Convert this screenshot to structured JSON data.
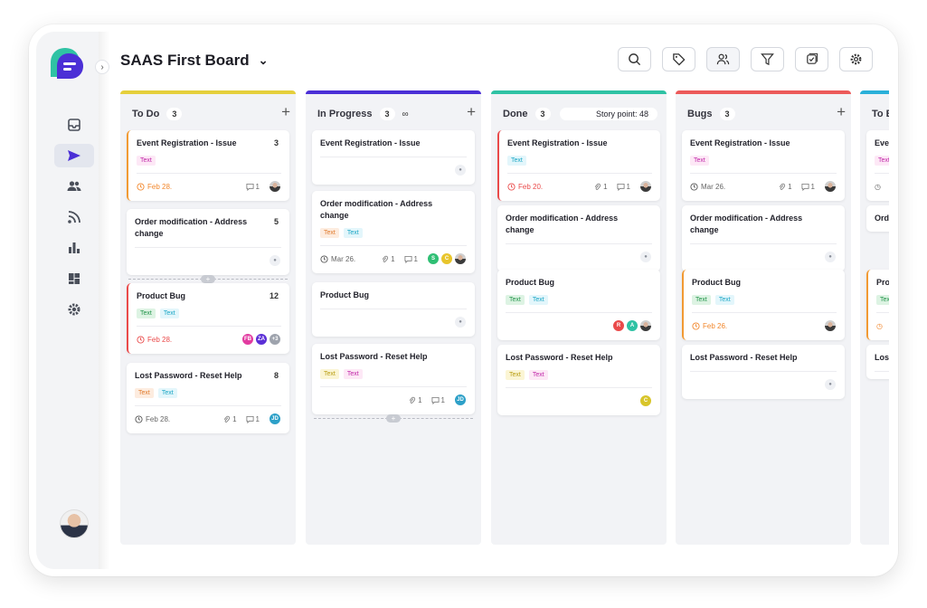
{
  "board": {
    "title": "SAAS First Board"
  },
  "toolbar": {
    "icons": [
      "search-icon",
      "tag-icon",
      "users-icon",
      "filter-icon",
      "checklist-icon",
      "settings-icon"
    ]
  },
  "colors": {
    "todo": "#e5cf3c",
    "inprogress": "#4b2fd6",
    "done": "#2fc2a4",
    "bugs": "#ec5a5a",
    "next": "#2ab0d9"
  },
  "columns": [
    {
      "title": "To Do",
      "count": "3",
      "cards": [
        {
          "title": "Event Registration - Issue",
          "num": "3",
          "tags": [
            "Text"
          ],
          "date": "Feb 28.",
          "comments": "1"
        },
        {
          "title": "Order modification - Address change",
          "num": "5"
        },
        {
          "title": "Product Bug",
          "num": "12",
          "tags": [
            "Text",
            "Text"
          ],
          "date": "Feb 28.",
          "avatars": [
            "FB",
            "ZA",
            "+3"
          ]
        },
        {
          "title": "Lost Password - Reset Help",
          "num": "8",
          "tags": [
            "Text",
            "Text"
          ],
          "date": "Feb 28.",
          "attachments": "1",
          "comments": "1",
          "avatars": [
            "JD"
          ]
        }
      ]
    },
    {
      "title": "In Progress",
      "count": "3",
      "cards": [
        {
          "title": "Event Registration - Issue"
        },
        {
          "title": "Order modification - Address change",
          "tags": [
            "Text",
            "Text"
          ],
          "date": "Mar 26.",
          "attachments": "1",
          "comments": "1",
          "avatars": [
            "S",
            "C"
          ]
        },
        {
          "title": "Product Bug"
        },
        {
          "title": "Lost Password - Reset Help",
          "tags": [
            "Text",
            "Text"
          ],
          "attachments": "1",
          "comments": "1",
          "avatars": [
            "JD"
          ]
        }
      ]
    },
    {
      "title": "Done",
      "count": "3",
      "story_point": "Story point: 48",
      "cards": [
        {
          "title": "Event Registration - Issue",
          "tags": [
            "Text"
          ],
          "date": "Feb 20.",
          "attachments": "1",
          "comments": "1"
        },
        {
          "title": "Order modification - Address change"
        },
        {
          "title": "Product Bug",
          "tags": [
            "Text",
            "Text"
          ],
          "avatars": [
            "R",
            "A"
          ]
        },
        {
          "title": "Lost Password - Reset Help",
          "tags": [
            "Text",
            "Text"
          ],
          "avatars": [
            "C"
          ]
        }
      ]
    },
    {
      "title": "Bugs",
      "count": "3",
      "cards": [
        {
          "title": "Event Registration - Issue",
          "tags": [
            "Text"
          ],
          "date": "Mar 26.",
          "attachments": "1",
          "comments": "1"
        },
        {
          "title": "Order modification - Address change"
        },
        {
          "title": "Product Bug",
          "tags": [
            "Text",
            "Text"
          ],
          "date": "Feb 26."
        },
        {
          "title": "Lost Password - Reset Help"
        }
      ]
    },
    {
      "title": "To B",
      "cards": [
        {
          "title": "Ever"
        },
        {
          "title": "Ord cha"
        },
        {
          "title": "Prod"
        },
        {
          "title": "Lost"
        }
      ]
    }
  ],
  "card_extra": {
    "tag_text": "Text",
    "icon_person": "person-icon"
  }
}
